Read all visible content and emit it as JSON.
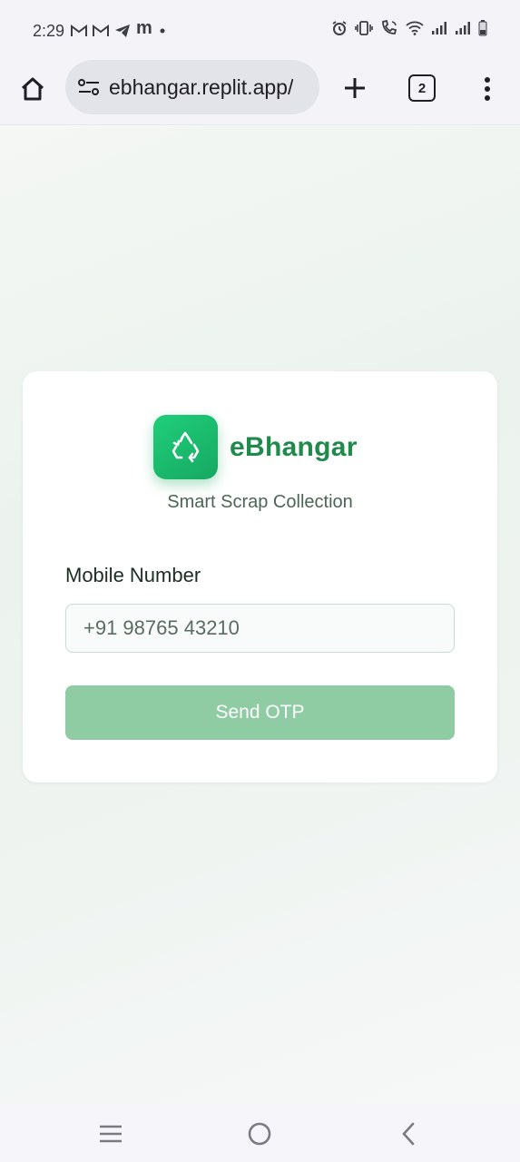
{
  "status_bar": {
    "time": "2:29",
    "left_icons": [
      "gmail-icon",
      "gmail-icon",
      "telegram-icon",
      "m-app-icon",
      "dot-icon"
    ],
    "right_icons": [
      "alarm-icon",
      "vibrate-icon",
      "wifi-call-icon",
      "wifi-icon",
      "signal-icon",
      "signal-icon",
      "battery-icon"
    ]
  },
  "browser": {
    "url": "ebhangar.replit.app/",
    "tab_count": "2"
  },
  "card": {
    "brand_name": "eBhangar",
    "tagline": "Smart Scrap Collection",
    "mobile_label": "Mobile Number",
    "mobile_placeholder": "+91 98765 43210",
    "mobile_value": "",
    "send_button": "Send OTP"
  },
  "colors": {
    "brand_green": "#1f8a4c",
    "logo_green": "#1fcf7a",
    "button_disabled": "#8fcca3"
  }
}
